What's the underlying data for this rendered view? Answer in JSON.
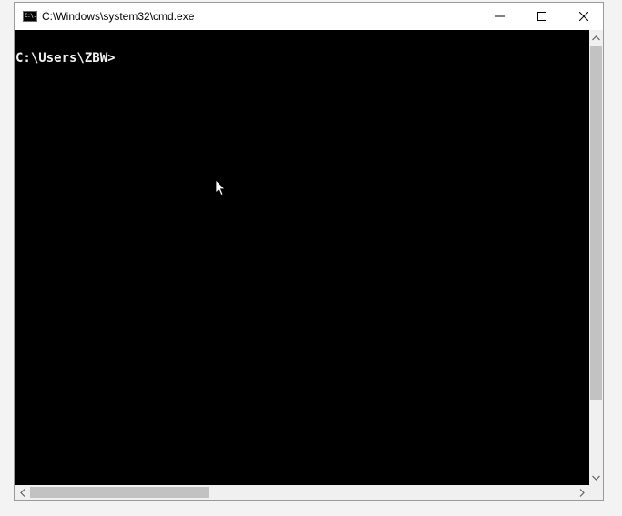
{
  "window": {
    "title": "C:\\Windows\\system32\\cmd.exe",
    "icon_text": "C:\\."
  },
  "console": {
    "prompt": "C:\\Users\\ZBW>"
  },
  "icons": {
    "app": "cmd-icon",
    "minimize": "minimize-icon",
    "maximize": "maximize-icon",
    "close": "close-icon",
    "scroll_up": "chevron-up-icon",
    "scroll_down": "chevron-down-icon",
    "scroll_left": "chevron-left-icon",
    "scroll_right": "chevron-right-icon",
    "cursor": "mouse-pointer-icon"
  },
  "colors": {
    "console_bg": "#000000",
    "console_fg": "#f0f0f0",
    "scrollbar_track": "#f0f0f0",
    "scrollbar_thumb": "#c2c2c2"
  }
}
